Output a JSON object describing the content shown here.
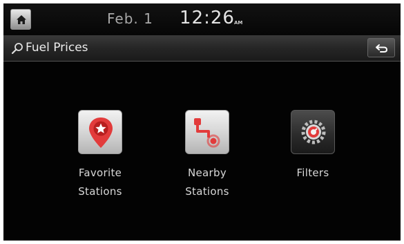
{
  "status": {
    "date": "Feb.  1",
    "time": "12:26",
    "ampm": "AM"
  },
  "header": {
    "title": "Fuel Prices"
  },
  "menu": [
    {
      "line1": "Favorite",
      "line2": "Stations",
      "icon": "favorite-pin-icon"
    },
    {
      "line1": "Nearby",
      "line2": "Stations",
      "icon": "nearby-route-icon"
    },
    {
      "line1": "Filters",
      "line2": "",
      "icon": "filter-gear-icon"
    }
  ],
  "colors": {
    "accent_red": "#e23b3b",
    "background": "#030303",
    "text": "#d8d8d8"
  }
}
